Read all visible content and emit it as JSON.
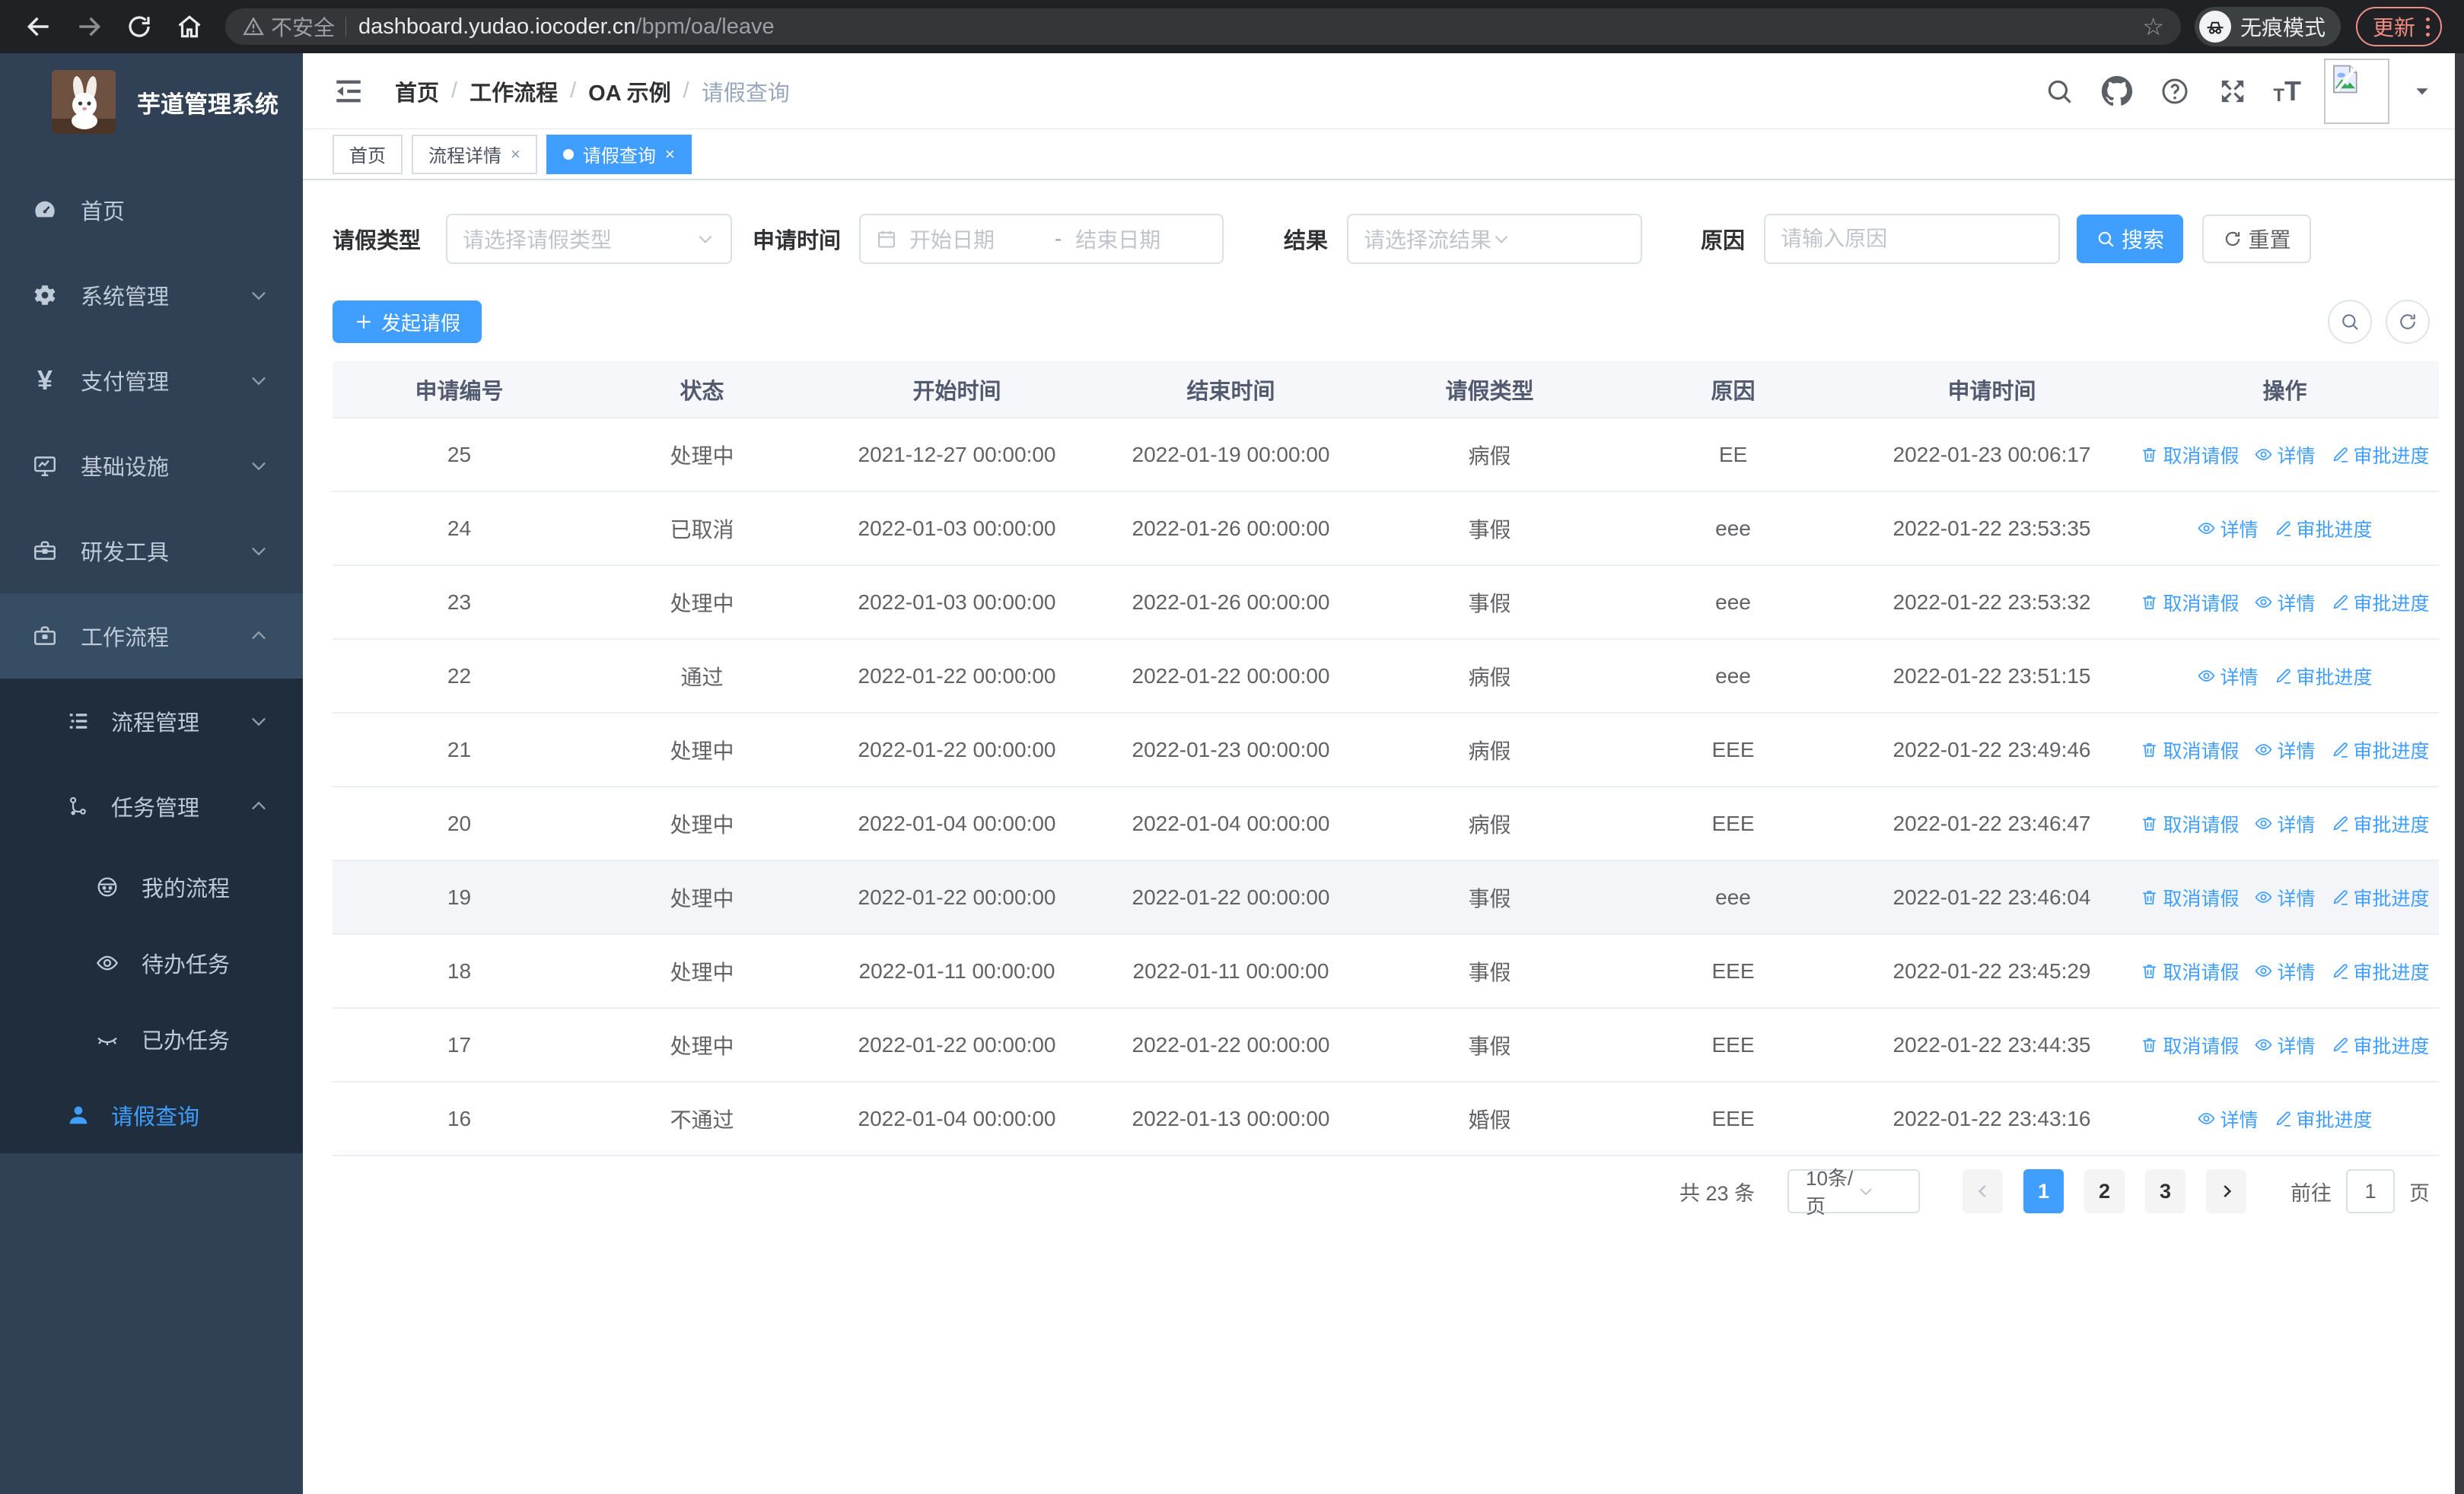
{
  "browser": {
    "security_label": "不安全",
    "url_host": "dashboard.yudao.iocoder.cn",
    "url_path": "/bpm/oa/leave",
    "incognito_label": "无痕模式",
    "update_label": "更新",
    "nav_icons": [
      "back-icon",
      "forward-icon",
      "refresh-icon",
      "home-icon"
    ],
    "url_icons": [
      "warning-icon",
      "star-icon"
    ]
  },
  "sidebar": {
    "logo_title": "芋道管理系统",
    "menu": [
      {
        "key": "home",
        "label": "首页",
        "icon": "dashboard-icon",
        "level": 1,
        "arrow": null,
        "dark": false,
        "active": false,
        "parentActive": false
      },
      {
        "key": "system",
        "label": "系统管理",
        "icon": "gear-icon",
        "level": 1,
        "arrow": "down",
        "dark": false,
        "active": false,
        "parentActive": false
      },
      {
        "key": "payment",
        "label": "支付管理",
        "icon": "yen-icon",
        "level": 1,
        "arrow": "down",
        "dark": false,
        "active": false,
        "parentActive": false
      },
      {
        "key": "infra",
        "label": "基础设施",
        "icon": "monitor-icon",
        "level": 1,
        "arrow": "down",
        "dark": false,
        "active": false,
        "parentActive": false
      },
      {
        "key": "devtools",
        "label": "研发工具",
        "icon": "toolbox-icon",
        "level": 1,
        "arrow": "down",
        "dark": false,
        "active": false,
        "parentActive": false
      },
      {
        "key": "workflow",
        "label": "工作流程",
        "icon": "briefcase-icon",
        "level": 1,
        "arrow": "up",
        "dark": false,
        "active": false,
        "parentActive": true
      },
      {
        "key": "process-mgmt",
        "label": "流程管理",
        "icon": "list-icon",
        "level": 2,
        "arrow": "down",
        "dark": true,
        "active": false,
        "parentActive": false
      },
      {
        "key": "task-mgmt",
        "label": "任务管理",
        "icon": "workflow-icon",
        "level": 2,
        "arrow": "up",
        "dark": true,
        "active": false,
        "parentActive": false
      },
      {
        "key": "my-process",
        "label": "我的流程",
        "icon": "avatar-face-icon",
        "level": 3,
        "arrow": null,
        "dark": true,
        "active": false,
        "parentActive": false
      },
      {
        "key": "todo-task",
        "label": "待办任务",
        "icon": "eye-open-icon",
        "level": 3,
        "arrow": null,
        "dark": true,
        "active": false,
        "parentActive": false
      },
      {
        "key": "done-task",
        "label": "已办任务",
        "icon": "eye-closed-icon",
        "level": 3,
        "arrow": null,
        "dark": true,
        "active": false,
        "parentActive": false
      },
      {
        "key": "leave-query",
        "label": "请假查询",
        "icon": "user-icon",
        "level": 2,
        "arrow": null,
        "dark": true,
        "active": true,
        "parentActive": false,
        "short": true
      }
    ]
  },
  "navbar": {
    "breadcrumb": [
      "首页",
      "工作流程",
      "OA 示例",
      "请假查询"
    ],
    "right_icons": [
      "search-icon",
      "github-icon",
      "help-icon",
      "fullscreen-icon",
      "font-size-icon",
      "avatar-placeholder",
      "caret-down-icon"
    ]
  },
  "tabs": [
    {
      "key": "home",
      "label": "首页",
      "closable": false,
      "active": false
    },
    {
      "key": "process-detail",
      "label": "流程详情",
      "closable": true,
      "active": false
    },
    {
      "key": "leave-query",
      "label": "请假查询",
      "closable": true,
      "active": true
    }
  ],
  "filters": {
    "leave_type_label": "请假类型",
    "leave_type_placeholder": "请选择请假类型",
    "apply_time_label": "申请时间",
    "date_start_placeholder": "开始日期",
    "date_separator": "-",
    "date_end_placeholder": "结束日期",
    "result_label": "结果",
    "result_placeholder": "请选择流结果",
    "reason_label": "原因",
    "reason_placeholder": "请输入原因",
    "search_button": "搜索",
    "reset_button": "重置"
  },
  "toolbar": {
    "create_button": "发起请假"
  },
  "table": {
    "columns": [
      "申请编号",
      "状态",
      "开始时间",
      "结束时间",
      "请假类型",
      "原因",
      "申请时间",
      "操作"
    ],
    "action_labels": {
      "cancel": "取消请假",
      "detail": "详情",
      "progress": "审批进度"
    },
    "rows": [
      {
        "id": "25",
        "status": "处理中",
        "start": "2021-12-27 00:00:00",
        "end": "2022-01-19 00:00:00",
        "type": "病假",
        "reason": "EE",
        "applyTime": "2022-01-23 00:06:17",
        "actions": [
          "cancel",
          "detail",
          "progress"
        ],
        "highlighted": false
      },
      {
        "id": "24",
        "status": "已取消",
        "start": "2022-01-03 00:00:00",
        "end": "2022-01-26 00:00:00",
        "type": "事假",
        "reason": "eee",
        "applyTime": "2022-01-22 23:53:35",
        "actions": [
          "detail",
          "progress"
        ],
        "highlighted": false
      },
      {
        "id": "23",
        "status": "处理中",
        "start": "2022-01-03 00:00:00",
        "end": "2022-01-26 00:00:00",
        "type": "事假",
        "reason": "eee",
        "applyTime": "2022-01-22 23:53:32",
        "actions": [
          "cancel",
          "detail",
          "progress"
        ],
        "highlighted": false
      },
      {
        "id": "22",
        "status": "通过",
        "start": "2022-01-22 00:00:00",
        "end": "2022-01-22 00:00:00",
        "type": "病假",
        "reason": "eee",
        "applyTime": "2022-01-22 23:51:15",
        "actions": [
          "detail",
          "progress"
        ],
        "highlighted": false
      },
      {
        "id": "21",
        "status": "处理中",
        "start": "2022-01-22 00:00:00",
        "end": "2022-01-23 00:00:00",
        "type": "病假",
        "reason": "EEE",
        "applyTime": "2022-01-22 23:49:46",
        "actions": [
          "cancel",
          "detail",
          "progress"
        ],
        "highlighted": false
      },
      {
        "id": "20",
        "status": "处理中",
        "start": "2022-01-04 00:00:00",
        "end": "2022-01-04 00:00:00",
        "type": "病假",
        "reason": "EEE",
        "applyTime": "2022-01-22 23:46:47",
        "actions": [
          "cancel",
          "detail",
          "progress"
        ],
        "highlighted": false
      },
      {
        "id": "19",
        "status": "处理中",
        "start": "2022-01-22 00:00:00",
        "end": "2022-01-22 00:00:00",
        "type": "事假",
        "reason": "eee",
        "applyTime": "2022-01-22 23:46:04",
        "actions": [
          "cancel",
          "detail",
          "progress"
        ],
        "highlighted": true
      },
      {
        "id": "18",
        "status": "处理中",
        "start": "2022-01-11 00:00:00",
        "end": "2022-01-11 00:00:00",
        "type": "事假",
        "reason": "EEE",
        "applyTime": "2022-01-22 23:45:29",
        "actions": [
          "cancel",
          "detail",
          "progress"
        ],
        "highlighted": false
      },
      {
        "id": "17",
        "status": "处理中",
        "start": "2022-01-22 00:00:00",
        "end": "2022-01-22 00:00:00",
        "type": "事假",
        "reason": "EEE",
        "applyTime": "2022-01-22 23:44:35",
        "actions": [
          "cancel",
          "detail",
          "progress"
        ],
        "highlighted": false
      },
      {
        "id": "16",
        "status": "不通过",
        "start": "2022-01-04 00:00:00",
        "end": "2022-01-13 00:00:00",
        "type": "婚假",
        "reason": "EEE",
        "applyTime": "2022-01-22 23:43:16",
        "actions": [
          "detail",
          "progress"
        ],
        "highlighted": false
      }
    ],
    "action_icons": {
      "cancel": "trash-icon",
      "detail": "view-eye-icon",
      "progress": "edit-pen-icon"
    }
  },
  "pagination": {
    "total_text": "共 23 条",
    "page_size_text": "10条/页",
    "pages": [
      "1",
      "2",
      "3"
    ],
    "active_page": "1",
    "goto_label": "前往",
    "goto_value": "1",
    "page_unit": "页"
  },
  "colors": {
    "accent_blue": "#409eff",
    "sidebar_bg": "#304156",
    "submenu_bg": "#1f2d3d",
    "chrome_bg": "#202124",
    "update_red": "#f28b82",
    "table_border": "#ebeef5"
  }
}
